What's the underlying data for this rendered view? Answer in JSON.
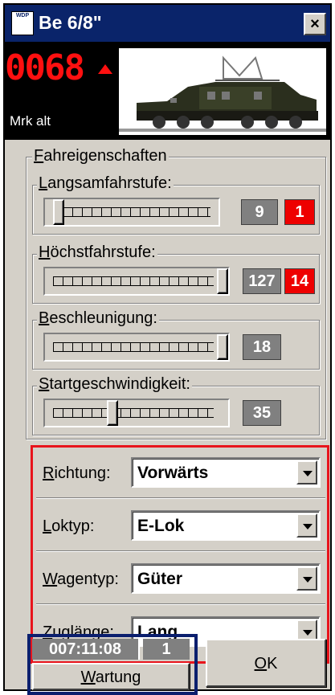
{
  "window": {
    "title": "Be 6/8\"",
    "app_icon_text": "WDP",
    "close_symbol": "×"
  },
  "loco": {
    "address": "0068",
    "direction": "up",
    "name": "Mrk alt"
  },
  "fahreigenschaften": {
    "title": "Fahreigenschaften",
    "title_mnemonic": "F",
    "sliders": [
      {
        "label": "Langsamfahrstufe:",
        "mnemonic": "L",
        "value": "9",
        "step": "1",
        "position": 0.05
      },
      {
        "label": "Höchstfahrstufe:",
        "mnemonic": "H",
        "value": "127",
        "step": "14",
        "position": 1.0
      },
      {
        "label": "Beschleunigung:",
        "mnemonic": "B",
        "value": "18",
        "position": 1.0
      },
      {
        "label": "Startgeschwindigkeit:",
        "mnemonic": "S",
        "value": "35",
        "position": 0.36
      }
    ]
  },
  "properties": [
    {
      "label": "Richtung:",
      "mnemonic": "R",
      "value": "Vorwärts"
    },
    {
      "label": "Loktyp:",
      "mnemonic": "L",
      "value": "E-Lok"
    },
    {
      "label": "Wagentyp:",
      "mnemonic": "W",
      "value": "Güter"
    },
    {
      "label": "Zuglänge:",
      "mnemonic": "Z",
      "value": "Lang"
    }
  ],
  "status": {
    "time": "007:11:08",
    "count": "1",
    "service_label": "Wartung",
    "service_mnemonic": "W"
  },
  "ok_button": {
    "label": "OK",
    "mnemonic": "O"
  },
  "colors": {
    "titlebar": "#0a246a",
    "accent_red": "#e8141c",
    "frame_blue": "#0b1f6e",
    "value_gray": "#808080"
  }
}
